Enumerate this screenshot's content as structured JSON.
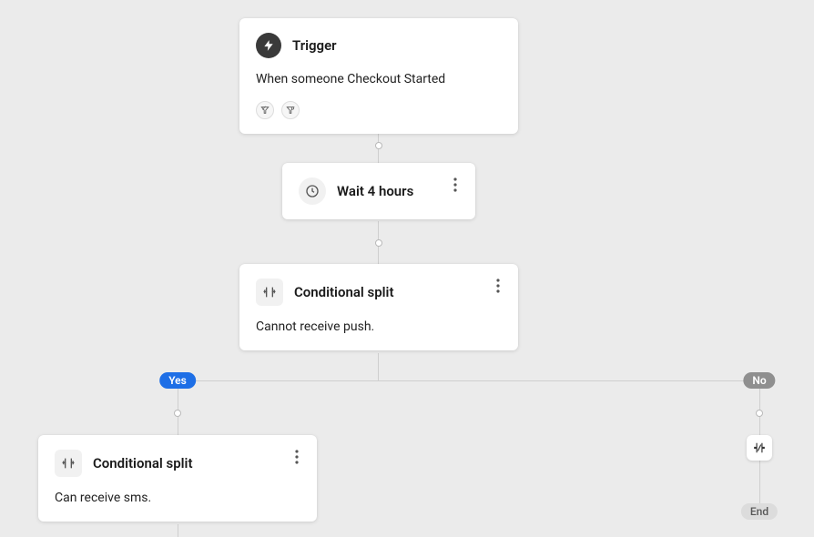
{
  "nodes": {
    "trigger": {
      "title": "Trigger",
      "body": "When someone Checkout Started"
    },
    "wait": {
      "title": "Wait 4 hours"
    },
    "split1": {
      "title": "Conditional split",
      "body": "Cannot receive push."
    },
    "split2": {
      "title": "Conditional split",
      "body": "Can receive sms."
    }
  },
  "branches": {
    "yes": "Yes",
    "no": "No",
    "end": "End"
  },
  "colors": {
    "yes_pill": "#1e6fe6",
    "no_pill": "#8f8f8f",
    "end_pill": "#dcdcdc",
    "edge": "#cfcfcf"
  }
}
